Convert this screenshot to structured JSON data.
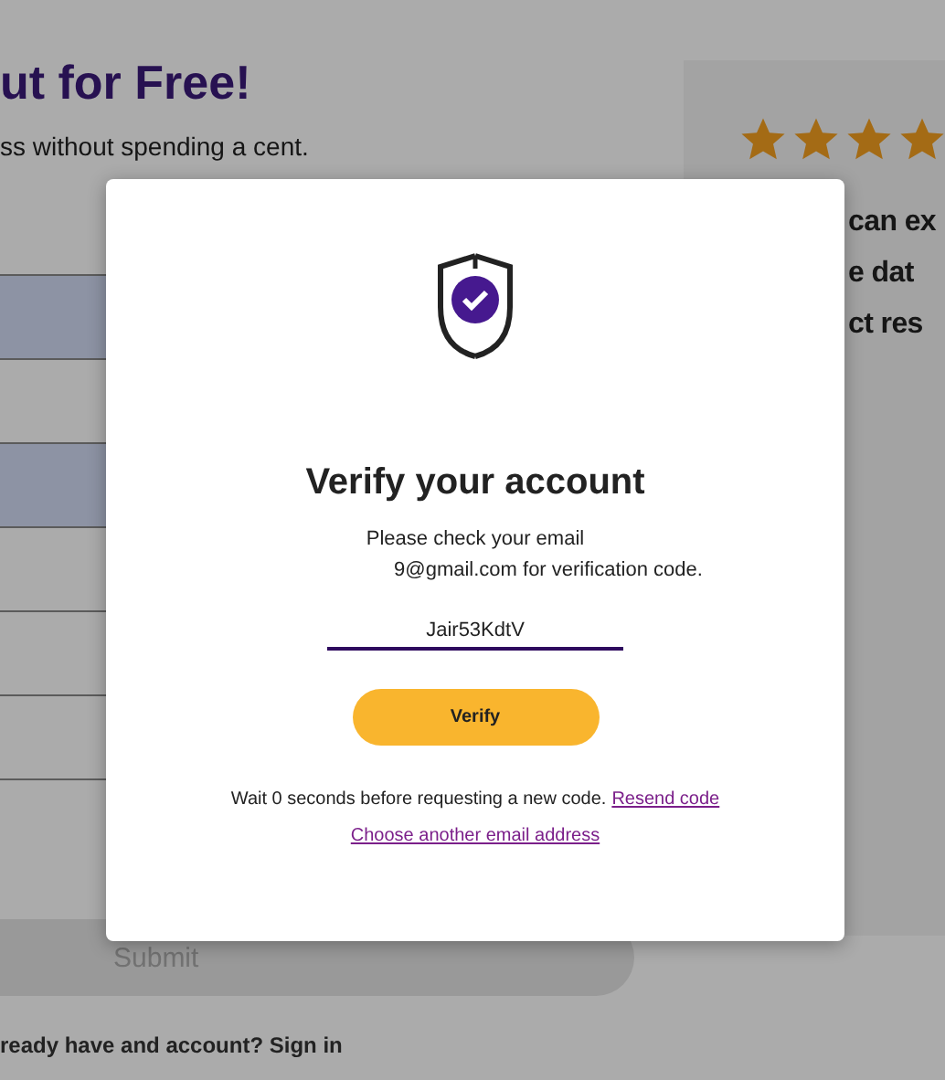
{
  "page": {
    "heading": "ut for Free!",
    "subheading": "ss without spending a cent.",
    "form_rows": [
      {
        "highlighted": true
      },
      {
        "highlighted": false
      },
      {
        "highlighted": true
      },
      {
        "highlighted": false
      },
      {
        "highlighted": false
      },
      {
        "highlighted": false
      },
      {
        "highlighted": false
      }
    ],
    "submit_button": "Submit",
    "signin_text": "ready have and account? Sign in"
  },
  "side_panel": {
    "stars": 4,
    "lines": [
      "can ex",
      "e dat",
      "ct res"
    ]
  },
  "dialog": {
    "title": "Verify your account",
    "message_line_1": "Please check your email",
    "message_line_2": "9@gmail.com for verification code.",
    "code_field": {
      "value": "Jair53KdtV"
    },
    "verify_button": "Verify",
    "wait_text": "Wait 0 seconds before requesting a new code.",
    "resend_link": "Resend code",
    "change_email_link": "Choose another email address"
  }
}
